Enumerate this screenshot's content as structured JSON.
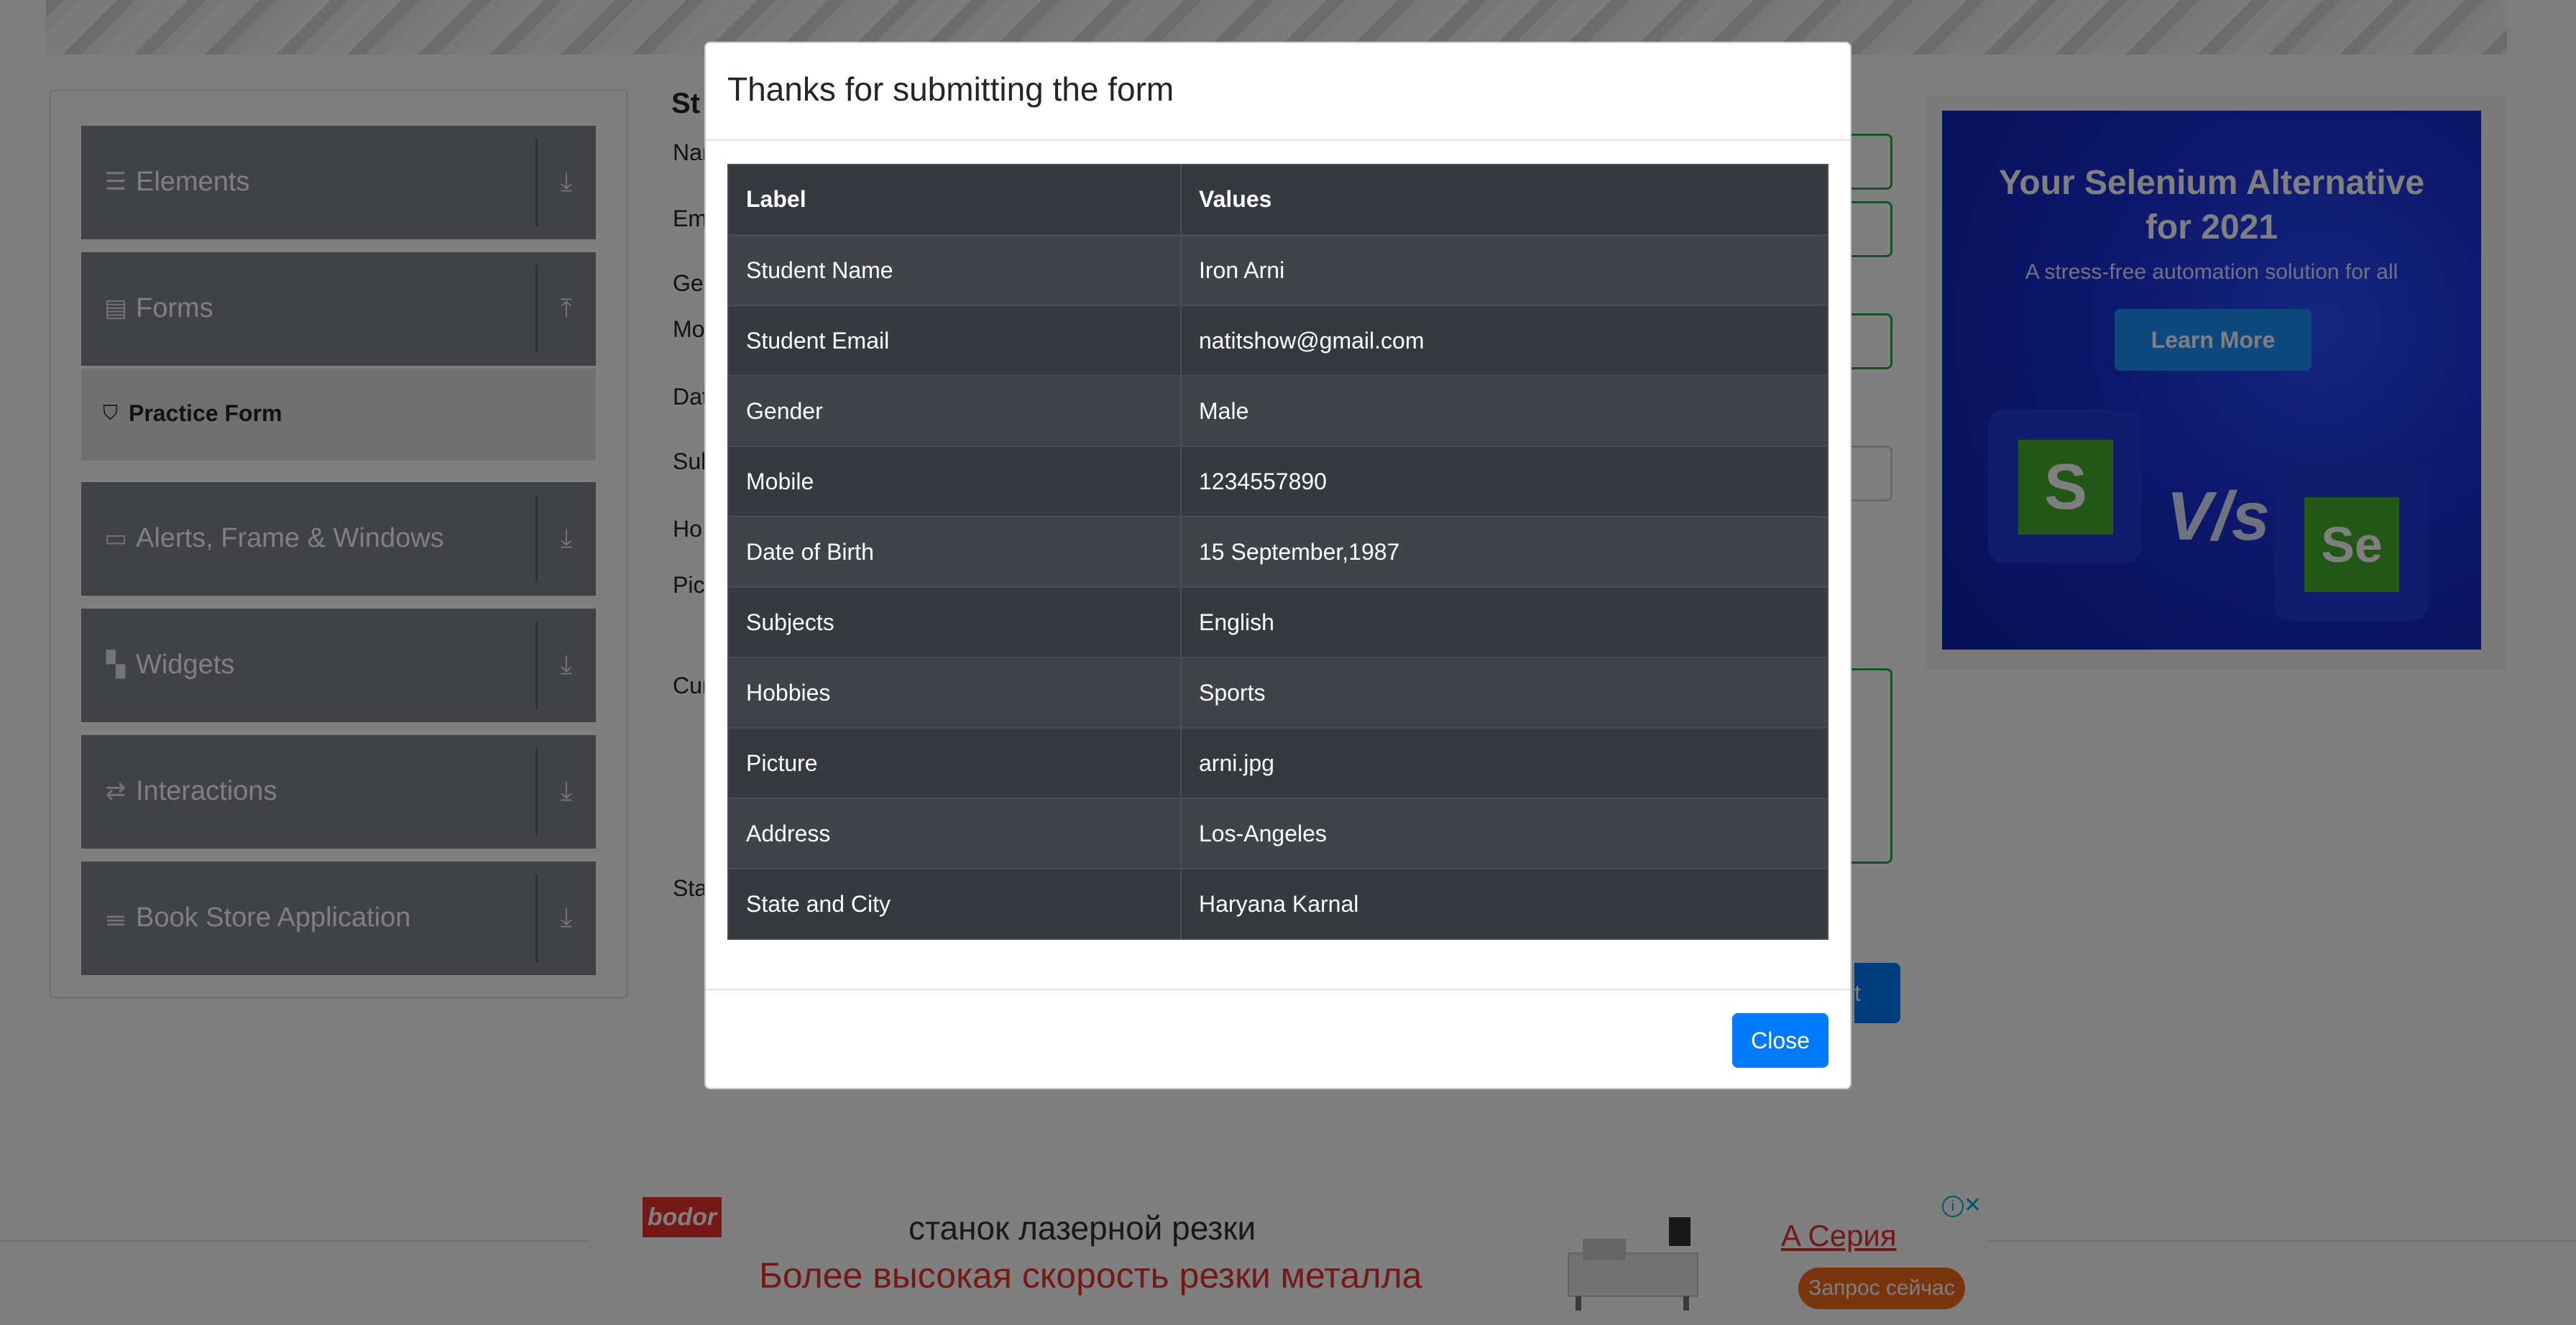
{
  "sidebar": {
    "groups": [
      {
        "label": "Elements",
        "icon": "hamburger-icon",
        "arrow": "download-icon"
      },
      {
        "label": "Forms",
        "icon": "document-icon",
        "arrow": "upload-icon"
      },
      {
        "label": "Alerts, Frame & Windows",
        "icon": "window-icon",
        "arrow": "download-icon"
      },
      {
        "label": "Widgets",
        "icon": "widgets-icon",
        "arrow": "download-icon"
      },
      {
        "label": "Interactions",
        "icon": "interactions-icon",
        "arrow": "download-icon"
      },
      {
        "label": "Book Store Application",
        "icon": "books-icon",
        "arrow": "download-icon"
      }
    ],
    "active_item": {
      "label": "Practice Form",
      "icon": "html5-icon"
    }
  },
  "form": {
    "title_fragment": "St",
    "labels": [
      "Nan",
      "Em",
      "Ge",
      "Mo",
      "Dat",
      "Sub",
      "Ho",
      "Pic",
      "Cur",
      "Sta"
    ],
    "submit_fragment": "t"
  },
  "side_ad": {
    "title_line1": "Your Selenium Alternative",
    "title_line2": "for 2021",
    "subtitle": "A stress-free automation solution for all",
    "button": "Learn More",
    "vs": "V/s",
    "left_logo": "S",
    "right_logo": "Se"
  },
  "bottom_ad": {
    "brand": "bodor",
    "line1": "станок лазерной резки",
    "line2": "Более высокая скорость резки металла",
    "series": "A Серия",
    "cta": "Запрос сейчас"
  },
  "modal": {
    "title": "Thanks for submitting the form",
    "headers": [
      "Label",
      "Values"
    ],
    "rows": [
      [
        "Student Name",
        "Iron Arni"
      ],
      [
        "Student Email",
        "natitshow@gmail.com"
      ],
      [
        "Gender",
        "Male"
      ],
      [
        "Mobile",
        "1234557890"
      ],
      [
        "Date of Birth",
        "15 September,1987"
      ],
      [
        "Subjects",
        "English"
      ],
      [
        "Hobbies",
        "Sports"
      ],
      [
        "Picture",
        "arni.jpg"
      ],
      [
        "Address",
        "Los-Angeles"
      ],
      [
        "State and City",
        "Haryana Karnal"
      ]
    ],
    "close_label": "Close"
  },
  "colors": {
    "primary": "#007bff",
    "sidebar_group": "#7f8691",
    "table_dark": "#343a40",
    "table_stripe": "#3e444a",
    "valid_green": "#28a745",
    "overlay": "rgba(0,0,0,0.5)"
  }
}
